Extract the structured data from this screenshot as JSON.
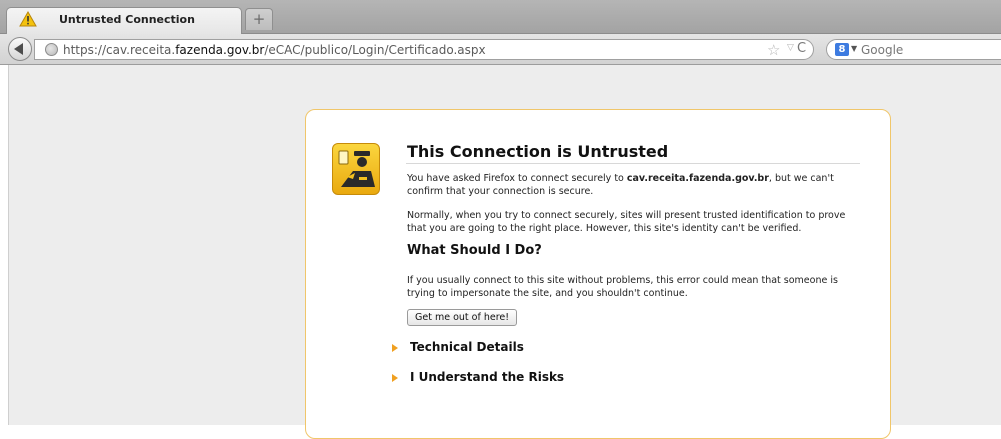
{
  "browser": {
    "tab": {
      "title": "Untrusted Connection",
      "icon": "warning-icon"
    },
    "new_tab_label": "+",
    "url": {
      "prefix": "https://cav.receita.",
      "domain": "fazenda.gov.br",
      "path": "/eCAC/publico/Login/Certificado.aspx"
    },
    "search": {
      "engine_icon": "8",
      "placeholder": "Google"
    },
    "star_glyph": "☆",
    "dropdown_glyph": "▽",
    "reload_glyph": "C"
  },
  "error_page": {
    "title": "This Connection is Untrusted",
    "p1_before": "You have asked Firefox to connect securely to ",
    "p1_host": "cav.receita.fazenda.gov.br",
    "p1_after": ", but we can't confirm that your connection is secure.",
    "p2": "Normally, when you try to connect securely, sites will present trusted identification to prove that you are going to the right place. However, this site's identity can't be verified.",
    "heading": "What Should I Do?",
    "p3": "If you usually connect to this site without problems, this error could mean that someone is trying to impersonate the site, and you shouldn't continue.",
    "button": "Get me out of here!",
    "expanders": [
      "Technical Details",
      "I Understand the Risks"
    ]
  },
  "colors": {
    "card_border": "#f0c66a",
    "badge": "#f5c21f",
    "expander_arrow": "#f0a020"
  }
}
